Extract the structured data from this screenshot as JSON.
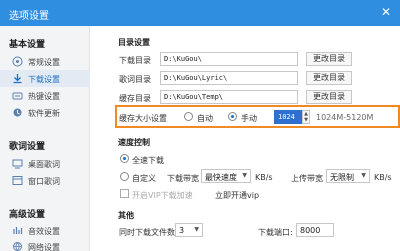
{
  "window": {
    "title": "选项设置",
    "close": "✕"
  },
  "sidebar": {
    "sections": [
      {
        "title": "基本设置",
        "items": [
          {
            "label": "常规设置",
            "icon": "home-icon"
          },
          {
            "label": "下载设置",
            "icon": "download-icon",
            "active": true
          },
          {
            "label": "热键设置",
            "icon": "keyboard-icon"
          },
          {
            "label": "软件更新",
            "icon": "update-icon"
          }
        ]
      },
      {
        "title": "歌词设置",
        "items": [
          {
            "label": "桌面歌词",
            "icon": "desktop-lyrics-icon"
          },
          {
            "label": "窗口歌词",
            "icon": "window-lyrics-icon"
          }
        ]
      },
      {
        "title": "高级设置",
        "items": [
          {
            "label": "音效设置",
            "icon": "sound-effect-icon"
          },
          {
            "label": "网络设置",
            "icon": "network-icon"
          }
        ]
      }
    ]
  },
  "dirs": {
    "title": "目录设置",
    "download": {
      "label": "下载目录",
      "value": "D:\\KuGou\\",
      "button": "更改目录"
    },
    "lyrics": {
      "label": "歌词目录",
      "value": "D:\\KuGou\\Lyric\\",
      "button": "更改目录"
    },
    "cache": {
      "label": "缓存目录",
      "value": "D:\\KuGou\\Temp\\",
      "button": "更改目录"
    }
  },
  "cache_size": {
    "label": "缓存大小设置",
    "auto": "自动",
    "manual": "手动",
    "value": "1024",
    "range": "1024M-5120M"
  },
  "speed": {
    "title": "速度控制",
    "full": "全速下载",
    "custom": "自定义",
    "down_label": "下载带宽",
    "down_value": "最快速度",
    "unit1": "KB/s",
    "up_label": "上传带宽",
    "up_value": "无限制",
    "unit2": "KB/s",
    "vip": "开启VIP下载加速",
    "vip_link": "立即开通vip"
  },
  "other": {
    "title": "其他",
    "tasks_label": "同时下载文件数:",
    "tasks_value": "3",
    "port_label": "下载端口:",
    "port_value": "8000"
  }
}
